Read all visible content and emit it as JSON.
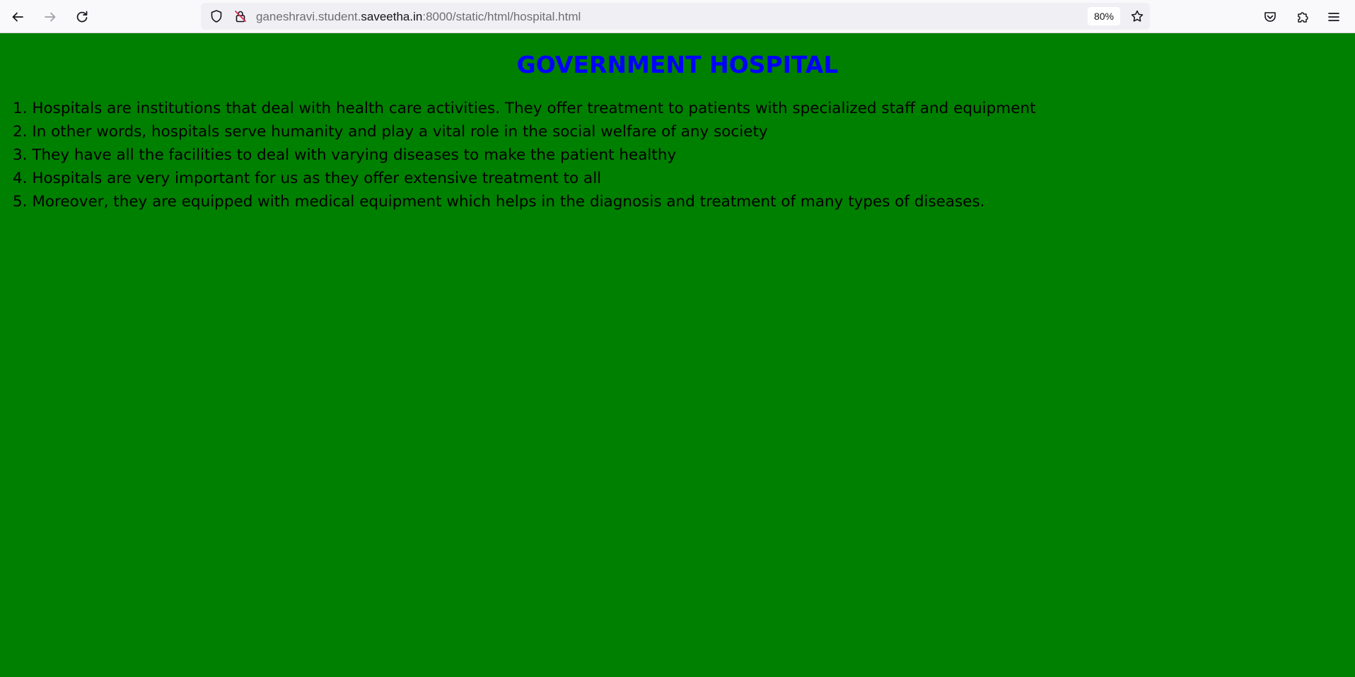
{
  "browser": {
    "url": {
      "prefix": "ganeshravi.student.",
      "domain": "saveetha.in",
      "suffix": ":8000/static/html/hospital.html"
    },
    "zoom_level": "80%",
    "icons": {
      "back": "back-arrow-icon",
      "forward": "forward-arrow-icon",
      "reload": "reload-icon",
      "tracking_protection": "shield-icon",
      "connection": "insecure-lock-icon",
      "bookmark": "star-icon",
      "pocket": "pocket-icon",
      "extensions": "puzzle-icon",
      "menu": "hamburger-menu-icon"
    }
  },
  "page": {
    "title": "GOVERNMENT HOSPITAL",
    "points": [
      "1. Hospitals are institutions that deal with health care activities. They offer treatment to patients with specialized staff and equipment",
      "2. In other words, hospitals serve humanity and play a vital role in the social welfare of any society",
      "3. They have all the facilities to deal with varying diseases to make the patient healthy",
      "4. Hospitals are very important for us as they offer extensive treatment to all",
      "5. Moreover, they are equipped with medical equipment which helps in the diagnosis and treatment of many types of diseases."
    ]
  },
  "colors": {
    "page_background": "#008000",
    "title": "#0000ff",
    "body_text": "#000000"
  }
}
